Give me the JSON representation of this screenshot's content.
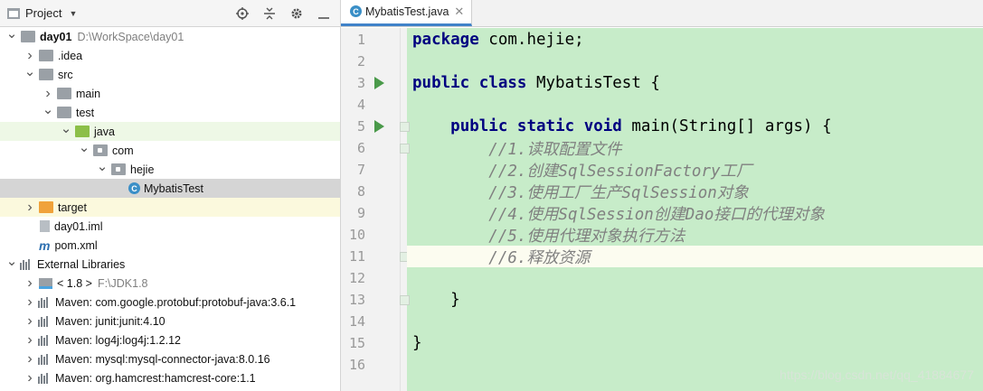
{
  "project_pane": {
    "title": "Project",
    "tree": [
      {
        "label": "day01",
        "extra": "D:\\WorkSpace\\day01",
        "depth": 0,
        "arrow": "down",
        "icon": "module-folder-icon",
        "bold": true
      },
      {
        "label": ".idea",
        "depth": 1,
        "arrow": "right",
        "icon": "folder-icon"
      },
      {
        "label": "src",
        "depth": 1,
        "arrow": "down",
        "icon": "folder-icon"
      },
      {
        "label": "main",
        "depth": 2,
        "arrow": "right",
        "icon": "folder-icon"
      },
      {
        "label": "test",
        "depth": 2,
        "arrow": "down",
        "icon": "folder-icon"
      },
      {
        "label": "java",
        "depth": 3,
        "arrow": "down",
        "icon": "test-source-folder-icon",
        "highlight": "green"
      },
      {
        "label": "com",
        "depth": 4,
        "arrow": "down",
        "icon": "package-icon"
      },
      {
        "label": "hejie",
        "depth": 5,
        "arrow": "down",
        "icon": "package-icon"
      },
      {
        "label": "MybatisTest",
        "depth": 6,
        "arrow": "",
        "icon": "class-icon",
        "selected": true
      },
      {
        "label": "target",
        "depth": 1,
        "arrow": "right",
        "icon": "excluded-folder-icon",
        "highlight": "yellow"
      },
      {
        "label": "day01.iml",
        "depth": 1,
        "arrow": "",
        "icon": "iml-file-icon"
      },
      {
        "label": "pom.xml",
        "depth": 1,
        "arrow": "",
        "icon": "maven-icon"
      },
      {
        "label": "External Libraries",
        "depth": 0,
        "arrow": "down",
        "icon": "library-icon"
      },
      {
        "label": "< 1.8 >",
        "extra": "F:\\JDK1.8",
        "depth": 1,
        "arrow": "right",
        "icon": "jdk-icon"
      },
      {
        "label": "Maven: com.google.protobuf:protobuf-java:3.6.1",
        "depth": 1,
        "arrow": "right",
        "icon": "library-icon"
      },
      {
        "label": "Maven: junit:junit:4.10",
        "depth": 1,
        "arrow": "right",
        "icon": "library-icon"
      },
      {
        "label": "Maven: log4j:log4j:1.2.12",
        "depth": 1,
        "arrow": "right",
        "icon": "library-icon"
      },
      {
        "label": "Maven: mysql:mysql-connector-java:8.0.16",
        "depth": 1,
        "arrow": "right",
        "icon": "library-icon"
      },
      {
        "label": "Maven: org.hamcrest:hamcrest-core:1.1",
        "depth": 1,
        "arrow": "right",
        "icon": "library-icon"
      }
    ]
  },
  "editor": {
    "tab_label": "MybatisTest.java",
    "lines": [
      {
        "n": "1",
        "tokens": [
          {
            "t": "package",
            "c": "kw"
          },
          {
            "t": " com.hejie;",
            "c": ""
          }
        ]
      },
      {
        "n": "2",
        "tokens": []
      },
      {
        "n": "3",
        "run": true,
        "tokens": [
          {
            "t": "public",
            "c": "kw"
          },
          {
            "t": " ",
            "c": ""
          },
          {
            "t": "class",
            "c": "kw"
          },
          {
            "t": " MybatisTest {",
            "c": ""
          }
        ]
      },
      {
        "n": "4",
        "tokens": []
      },
      {
        "n": "5",
        "run": true,
        "fold": true,
        "tokens": [
          {
            "t": "    ",
            "c": ""
          },
          {
            "t": "public",
            "c": "kw"
          },
          {
            "t": " ",
            "c": ""
          },
          {
            "t": "static",
            "c": "kw"
          },
          {
            "t": " ",
            "c": ""
          },
          {
            "t": "void",
            "c": "kw"
          },
          {
            "t": " main(String[] args) {",
            "c": ""
          }
        ]
      },
      {
        "n": "6",
        "fold": true,
        "tokens": [
          {
            "t": "        //1.读取配置文件",
            "c": "cm"
          }
        ]
      },
      {
        "n": "7",
        "tokens": [
          {
            "t": "        //2.创建SqlSessionFactory工厂",
            "c": "cm"
          }
        ]
      },
      {
        "n": "8",
        "tokens": [
          {
            "t": "        //3.使用工厂生产SqlSession对象",
            "c": "cm"
          }
        ]
      },
      {
        "n": "9",
        "tokens": [
          {
            "t": "        //4.使用SqlSession创建Dao接口的代理对象",
            "c": "cm"
          }
        ]
      },
      {
        "n": "10",
        "tokens": [
          {
            "t": "        //5.使用代理对象执行方法",
            "c": "cm"
          }
        ]
      },
      {
        "n": "11",
        "fold": true,
        "bulb": true,
        "caret": true,
        "tokens": [
          {
            "t": "        //6.释放资源",
            "c": "cm"
          }
        ]
      },
      {
        "n": "12",
        "tokens": []
      },
      {
        "n": "13",
        "fold": true,
        "tokens": [
          {
            "t": "    }",
            "c": ""
          }
        ]
      },
      {
        "n": "14",
        "tokens": []
      },
      {
        "n": "15",
        "tokens": [
          {
            "t": "}",
            "c": ""
          }
        ]
      },
      {
        "n": "16",
        "tokens": []
      }
    ]
  },
  "watermark": "https://blog.csdn.net/qq_41884677",
  "colors": {
    "editor_background": "#c7ecc9",
    "keyword": "#000080",
    "comment": "#808080",
    "run_marker": "#4a9a4a",
    "tab_underline": "#4083c9"
  }
}
